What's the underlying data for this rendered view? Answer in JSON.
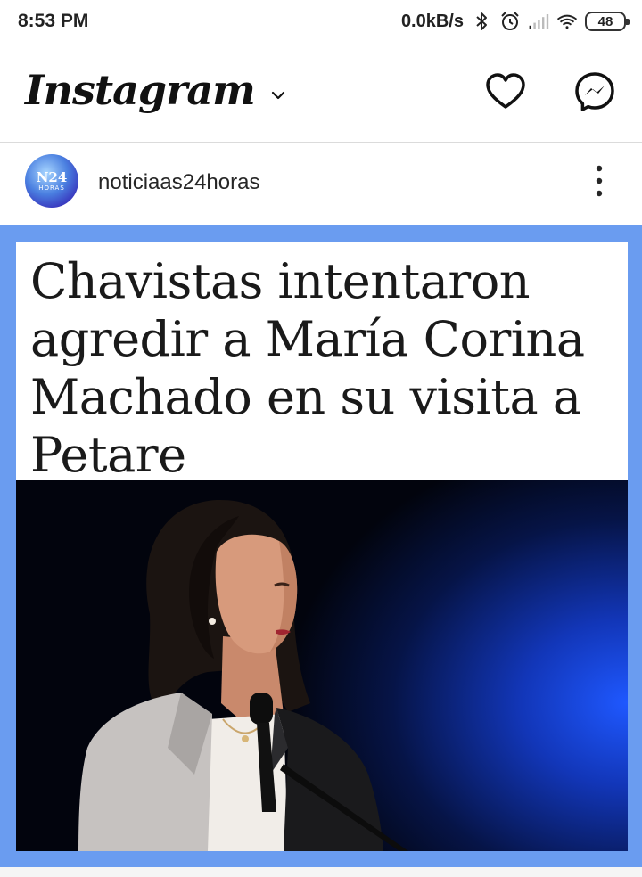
{
  "status_bar": {
    "time": "8:53 PM",
    "network_speed": "0.0kB/s",
    "battery": "48",
    "icons": [
      "bluetooth-icon",
      "alarm-icon",
      "signal-icon",
      "wifi-icon",
      "battery-icon"
    ]
  },
  "app": {
    "logo": "Instagram",
    "icons": {
      "chevron": "chevron-down-icon",
      "activity": "heart-icon",
      "messages": "messenger-icon"
    }
  },
  "post": {
    "avatar_text": "N24",
    "avatar_subtext": "HORAS",
    "username": "noticiaas24horas",
    "headline": "Chavistas intentaron agredir a María Corina Machado en su visita a Petare",
    "colors": {
      "frame": "#6a9cf0",
      "photo_glow": "#1f58ff"
    }
  }
}
